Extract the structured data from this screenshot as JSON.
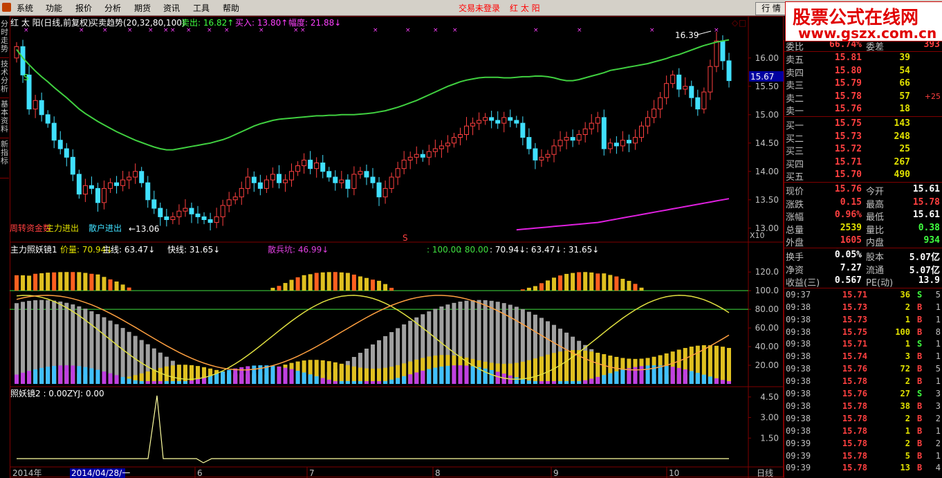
{
  "menu": [
    "系统",
    "功能",
    "报价",
    "分析",
    "期货",
    "资讯",
    "工具",
    "帮助"
  ],
  "status": {
    "login": "交易未登录",
    "name": "红 太 阳"
  },
  "trade_button": "行 情",
  "watermark": {
    "line1": "股票公式在线网",
    "line2": "www.gszx.com.cn"
  },
  "left_tabs": [
    "分时走势",
    "技术分析",
    "基本资料",
    "新指标"
  ],
  "colors": {
    "up": "#ff4040",
    "down": "#40e0ff",
    "ma_green": "#40d040",
    "ma_magenta": "#e020e0",
    "border": "#800000",
    "yellow": "#e0e000"
  },
  "main_panel": {
    "header": {
      "stock": "红 太 阳(日线,前复权)",
      "indicator": "买卖趋势(20,32,80,100)",
      "sell_label": "卖出: 16.82",
      "buy_label": "买入: 13.80",
      "range_label": "幅度: 21.88"
    },
    "annotations": {
      "high": "16.39",
      "low": "13.06",
      "s_mark": "S",
      "legend1": "周转资金数",
      "legend2": "主力进出",
      "legend3": "散户进出",
      "s_bottom": "S"
    },
    "price_current": "15.67",
    "x10": "X10"
  },
  "indicator1": {
    "name": "主力照妖镜1",
    "labels": [
      {
        "text": "价量: 70.94",
        "color": "#e0e000"
      },
      {
        "text": "主线: 63.47",
        "color": "#ffffff"
      },
      {
        "text": "快线: 31.65",
        "color": "#ffffff"
      },
      {
        "text": "散兵坑: 46.99",
        "color": "#e040e0"
      },
      {
        "text": ": 100.00",
        "color": "#40e040"
      },
      {
        "text": ": 80.00",
        "color": "#40e040"
      },
      {
        "text": ": 70.94",
        "color": "#ffffff"
      },
      {
        "text": ": 63.47",
        "color": "#ffffff"
      },
      {
        "text": ": 31.65",
        "color": "#ffffff"
      }
    ]
  },
  "indicator2": {
    "name": "照妖镜2 : 0.00",
    "zyj": "ZYJ: 0.00"
  },
  "x_axis": {
    "start": "2014年",
    "cursor": "2014/04/28/一",
    "months": [
      "6",
      "7",
      "8",
      "9",
      "10"
    ],
    "period": "日线"
  },
  "chart_data": {
    "type": "candlestick",
    "main_y_ticks": [
      "16.00",
      "15.50",
      "15.00",
      "14.50",
      "14.00",
      "13.50",
      "13.00"
    ],
    "ind1_y_ticks": [
      "120.0",
      "100.0",
      "80.00",
      "60.00",
      "40.00",
      "20.00"
    ],
    "ind2_y_ticks": [
      "4.50",
      "3.00",
      "1.50"
    ],
    "closes": [
      16.2,
      15.7,
      15.1,
      15.25,
      15.0,
      14.85,
      14.55,
      14.4,
      14.25,
      13.95,
      13.6,
      13.75,
      13.7,
      13.45,
      13.7,
      13.8,
      13.75,
      13.85,
      13.9,
      14.0,
      13.8,
      13.5,
      13.35,
      13.2,
      13.15,
      13.2,
      13.3,
      13.35,
      13.25,
      13.2,
      13.15,
      13.1,
      13.2,
      13.4,
      13.5,
      13.55,
      13.7,
      13.9,
      13.8,
      13.7,
      13.85,
      13.95,
      13.8,
      13.85,
      14.0,
      14.1,
      14.2,
      14.05,
      14.15,
      14.0,
      13.9,
      13.8,
      13.85,
      13.7,
      13.95,
      14.0,
      13.9,
      13.8,
      13.55,
      13.7,
      13.9,
      14.05,
      14.2,
      14.25,
      14.3,
      14.25,
      14.35,
      14.4,
      14.45,
      14.5,
      14.6,
      14.65,
      14.8,
      14.85,
      14.9,
      14.95,
      14.9,
      14.85,
      14.95,
      14.9,
      14.85,
      14.6,
      14.4,
      14.2,
      14.25,
      14.3,
      14.45,
      14.55,
      14.6,
      14.55,
      14.65,
      14.75,
      14.85,
      14.95,
      14.4,
      14.5,
      14.45,
      14.55,
      14.5,
      14.6,
      14.8,
      14.95,
      15.1,
      15.3,
      15.55,
      15.7,
      15.45,
      15.5,
      15.3,
      15.1,
      15.4,
      15.85,
      16.3,
      15.95,
      15.6
    ],
    "ma_upper": [
      16.15,
      16.0,
      15.88,
      15.77,
      15.67,
      15.58,
      15.48,
      15.39,
      15.3,
      15.2,
      15.1,
      15.02,
      14.95,
      14.88,
      14.82,
      14.76,
      14.7,
      14.65,
      14.6,
      14.55,
      14.51,
      14.47,
      14.43,
      14.4,
      14.38,
      14.38,
      14.4,
      14.42,
      14.44,
      14.46,
      14.48,
      14.5,
      14.53,
      14.56,
      14.6,
      14.65,
      14.7,
      14.75,
      14.8,
      14.84,
      14.87,
      14.9,
      14.92,
      14.93,
      14.94,
      14.95,
      14.96,
      14.97,
      14.98,
      14.98,
      14.99,
      14.99,
      15.0,
      15.0,
      15.0,
      15.01,
      15.02,
      15.03,
      15.05,
      15.07,
      15.1,
      15.13,
      15.17,
      15.21,
      15.25,
      15.3,
      15.35,
      15.4,
      15.45,
      15.5,
      15.54,
      15.58,
      15.61,
      15.63,
      15.65,
      15.66,
      15.66,
      15.66,
      15.65,
      15.65,
      15.66,
      15.67,
      15.67,
      15.68,
      15.68,
      15.67,
      15.65,
      15.62,
      15.6,
      15.6,
      15.62,
      15.65,
      15.68,
      15.71,
      15.74,
      15.78,
      15.8,
      15.82,
      15.84,
      15.86,
      15.88,
      15.9,
      15.93,
      15.96,
      15.99,
      16.03,
      16.06,
      16.1,
      16.14,
      16.18,
      16.22,
      16.25,
      16.28,
      16.3,
      16.32
    ],
    "ma_lower_start_index": 80,
    "ma_lower": [
      12.97,
      12.98,
      12.99,
      13.0,
      13.01,
      13.02,
      13.03,
      13.04,
      13.05,
      13.06,
      13.07,
      13.08,
      13.09,
      13.1,
      13.12,
      13.14,
      13.16,
      13.18,
      13.2,
      13.22,
      13.24,
      13.26,
      13.28,
      13.3,
      13.32,
      13.34,
      13.36,
      13.38,
      13.4,
      13.42,
      13.44,
      13.46,
      13.48,
      13.5,
      13.52
    ]
  },
  "quote": {
    "top_label": "委比",
    "top_value": "66.74%",
    "top_label2": "委差",
    "top_value2": "393",
    "asks": [
      {
        "label": "卖五",
        "price": "15.81",
        "vol": "39",
        "chg": ""
      },
      {
        "label": "卖四",
        "price": "15.80",
        "vol": "54",
        "chg": ""
      },
      {
        "label": "卖三",
        "price": "15.79",
        "vol": "66",
        "chg": ""
      },
      {
        "label": "卖二",
        "price": "15.78",
        "vol": "57",
        "chg": "+25"
      },
      {
        "label": "卖一",
        "price": "15.76",
        "vol": "18",
        "chg": ""
      }
    ],
    "bids": [
      {
        "label": "买一",
        "price": "15.75",
        "vol": "143"
      },
      {
        "label": "买二",
        "price": "15.73",
        "vol": "248"
      },
      {
        "label": "买三",
        "price": "15.72",
        "vol": "25"
      },
      {
        "label": "买四",
        "price": "15.71",
        "vol": "267"
      },
      {
        "label": "买五",
        "price": "15.70",
        "vol": "490"
      }
    ],
    "stats": [
      {
        "l1": "现价",
        "v1": "15.76",
        "c1": "#ff4040",
        "l2": "今开",
        "v2": "15.61",
        "c2": "#ffffff"
      },
      {
        "l1": "涨跌",
        "v1": "0.15",
        "c1": "#ff4040",
        "l2": "最高",
        "v2": "15.78",
        "c2": "#ff4040"
      },
      {
        "l1": "涨幅",
        "v1": "0.96%",
        "c1": "#ff4040",
        "l2": "最低",
        "v2": "15.61",
        "c2": "#ffffff"
      },
      {
        "l1": "总量",
        "v1": "2539",
        "c1": "#e0e000",
        "l2": "量比",
        "v2": "0.38",
        "c2": "#40ff40"
      },
      {
        "l1": "外盘",
        "v1": "1605",
        "c1": "#ff4040",
        "l2": "内盘",
        "v2": "934",
        "c2": "#40ff40"
      }
    ],
    "stats2": [
      {
        "l1": "换手",
        "v1": "0.05%",
        "l2": "股本",
        "v2": "5.07亿"
      },
      {
        "l1": "净资",
        "v1": "7.27",
        "l2": "流通",
        "v2": "5.07亿"
      },
      {
        "l1": "收益(三)",
        "v1": "0.567",
        "l2": "PE(动)",
        "v2": "13.9"
      }
    ],
    "ticks": [
      {
        "t": "09:37",
        "p": "15.71",
        "v": "36",
        "bs": "S",
        "n": "5"
      },
      {
        "t": "09:38",
        "p": "15.73",
        "v": "2",
        "bs": "B",
        "n": "1"
      },
      {
        "t": "09:38",
        "p": "15.73",
        "v": "1",
        "bs": "B",
        "n": "1"
      },
      {
        "t": "09:38",
        "p": "15.75",
        "v": "100",
        "bs": "B",
        "n": "8"
      },
      {
        "t": "09:38",
        "p": "15.71",
        "v": "1",
        "bs": "S",
        "n": "1"
      },
      {
        "t": "09:38",
        "p": "15.74",
        "v": "3",
        "bs": "B",
        "n": "1"
      },
      {
        "t": "09:38",
        "p": "15.76",
        "v": "72",
        "bs": "B",
        "n": "5"
      },
      {
        "t": "09:38",
        "p": "15.78",
        "v": "2",
        "bs": "B",
        "n": "1"
      },
      {
        "t": "09:38",
        "p": "15.76",
        "v": "27",
        "bs": "S",
        "n": "3"
      },
      {
        "t": "09:38",
        "p": "15.78",
        "v": "38",
        "bs": "B",
        "n": "3"
      },
      {
        "t": "09:38",
        "p": "15.78",
        "v": "2",
        "bs": "B",
        "n": "2"
      },
      {
        "t": "09:38",
        "p": "15.78",
        "v": "1",
        "bs": "B",
        "n": "1"
      },
      {
        "t": "09:39",
        "p": "15.78",
        "v": "2",
        "bs": "B",
        "n": "2"
      },
      {
        "t": "09:39",
        "p": "15.78",
        "v": "5",
        "bs": "B",
        "n": "1"
      },
      {
        "t": "09:39",
        "p": "15.78",
        "v": "13",
        "bs": "B",
        "n": "4"
      }
    ]
  }
}
